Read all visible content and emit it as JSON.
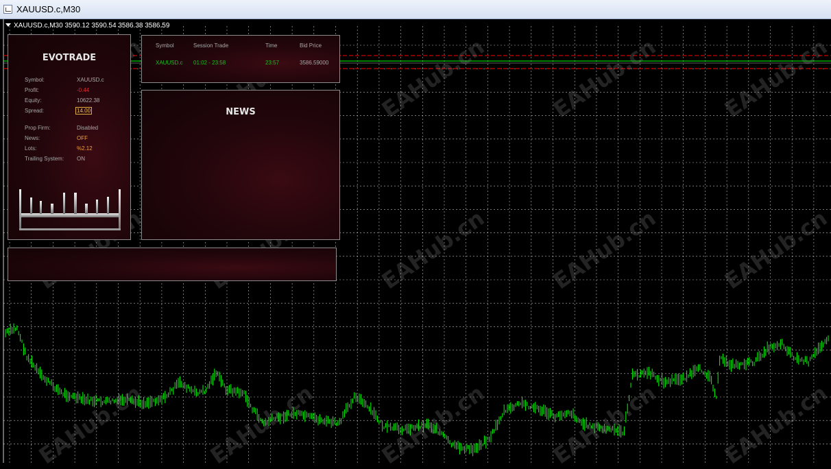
{
  "window": {
    "title": "XAUUSD.c,M30",
    "icon": "chart-window-icon"
  },
  "chart": {
    "header": "XAUUSD.c,M30  3590.12 3590.54 3586.38 3586.59",
    "background": "#000000",
    "candle_color": "#00ff00",
    "grid_color": "#ffffff",
    "level_line_colors": [
      "#ff0000",
      "#00ff00"
    ]
  },
  "watermark": "EAHub.cn",
  "evotrade": {
    "brand": "EVOTRADE",
    "symbol_label": "Symbol:",
    "symbol_value": "XAUUSD.c",
    "profit_label": "Profit:",
    "profit_value": "-0.44",
    "equity_label": "Equity:",
    "equity_value": "10622.38",
    "spread_label": "Spread:",
    "spread_value": "14.00",
    "propfirm_label": "Prop Firm:",
    "propfirm_value": "Disabled",
    "news_label": "News:",
    "news_value": "OFF",
    "lots_label": "Lots:",
    "lots_value": "%2.12",
    "trailing_label": "Trailing System:",
    "trailing_value": "ON"
  },
  "session_table": {
    "headers": [
      "Symbol",
      "Session Trade",
      "Time",
      "Bid Price"
    ],
    "row": [
      "XAUUSD.c",
      "01:02 - 23:58",
      "23:57",
      "3586.59000"
    ]
  },
  "news_panel": {
    "title": "NEWS"
  }
}
